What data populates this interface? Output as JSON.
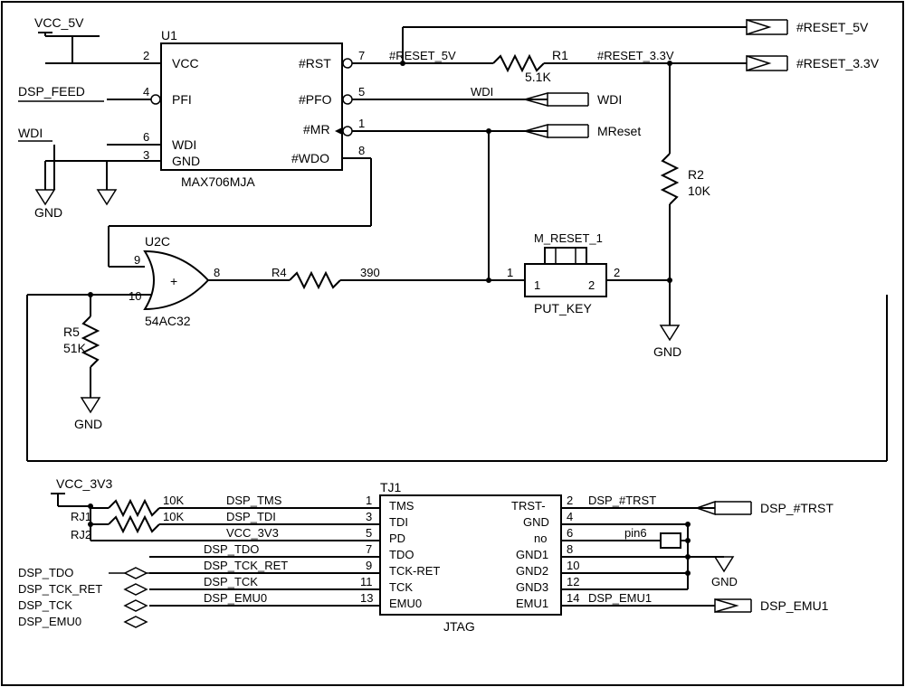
{
  "nets": {
    "vcc5v": "VCC_5V",
    "dsp_feed": "DSP_FEED",
    "wdi": "WDI",
    "gnd": "GND",
    "reset5v": "#RESET_5V",
    "reset33v": "#RESET_3.3V",
    "reset5v_wire": "#RESET_5V",
    "reset33v_wire": "#RESET_3.3V",
    "wdi_port": "WDI",
    "mreset": "MReset",
    "mreset1": "M_RESET_1",
    "put_key": "PUT_KEY",
    "vcc3v3": "VCC_3V3",
    "dsp_tdo": "DSP_TDO",
    "dsp_tck_ret": "DSP_TCK_RET",
    "dsp_tck": "DSP_TCK",
    "dsp_emu0": "DSP_EMU0",
    "dsp_trst": "DSP_#TRST",
    "dsp_emu1": "DSP_EMU1",
    "pin6": "pin6"
  },
  "parts": {
    "u1_ref": "U1",
    "u1_type": "MAX706MJA",
    "u2c_ref": "U2C",
    "u2c_type": "54AC32",
    "tj1_ref": "TJ1",
    "tj1_type": "JTAG",
    "r1_ref": "R1",
    "r1_val": "5.1K",
    "r2_ref": "R2",
    "r2_val": "10K",
    "r4_ref": "R4",
    "r4_val": "390",
    "r5_ref": "R5",
    "r5_val": "51K",
    "rj1_ref": "RJ1",
    "rj1_val": "10K",
    "rj2_ref": "RJ2",
    "rj2_val": "10K"
  },
  "u1_pins": {
    "vcc": "VCC",
    "pfi": "PFI",
    "wdi": "WDI",
    "gnd": "GND",
    "rst": "#RST",
    "pfo": "#PFO",
    "mr": "#MR",
    "wdo": "#WDO",
    "p1": "1",
    "p2": "2",
    "p3": "3",
    "p4": "4",
    "p5": "5",
    "p6": "6",
    "p7": "7",
    "p8": "8"
  },
  "jtag_pins": {
    "tms": "TMS",
    "tdi": "TDI",
    "pd": "PD",
    "tdo": "TDO",
    "tckret": "TCK-RET",
    "tck": "TCK",
    "emu0": "EMU0",
    "trst": "TRST-",
    "gnd": "GND",
    "no": "no",
    "gnd1": "GND1",
    "gnd2": "GND2",
    "gnd3": "GND3",
    "emu1": "EMU1",
    "p1": "1",
    "p2": "2",
    "p3": "3",
    "p4": "4",
    "p5": "5",
    "p6": "6",
    "p7": "7",
    "p8": "8",
    "p9": "9",
    "p10": "10",
    "p11": "11",
    "p12": "12",
    "p13": "13",
    "p14": "14"
  },
  "jtag_signals": {
    "dsp_tms": "DSP_TMS",
    "dsp_tdi": "DSP_TDI",
    "vcc3v3": "VCC_3V3",
    "dsp_tdo": "DSP_TDO",
    "dsp_tck_ret": "DSP_TCK_RET",
    "dsp_tck": "DSP_TCK",
    "dsp_emu0": "DSP_EMU0",
    "dsp_trst": "DSP_#TRST",
    "dsp_emu1": "DSP_EMU1"
  },
  "gate": {
    "plus": "+",
    "p8": "8",
    "p9": "9",
    "p10": "10"
  },
  "switch": {
    "p1": "1",
    "p2": "2",
    "t1": "1",
    "t2": "2"
  }
}
